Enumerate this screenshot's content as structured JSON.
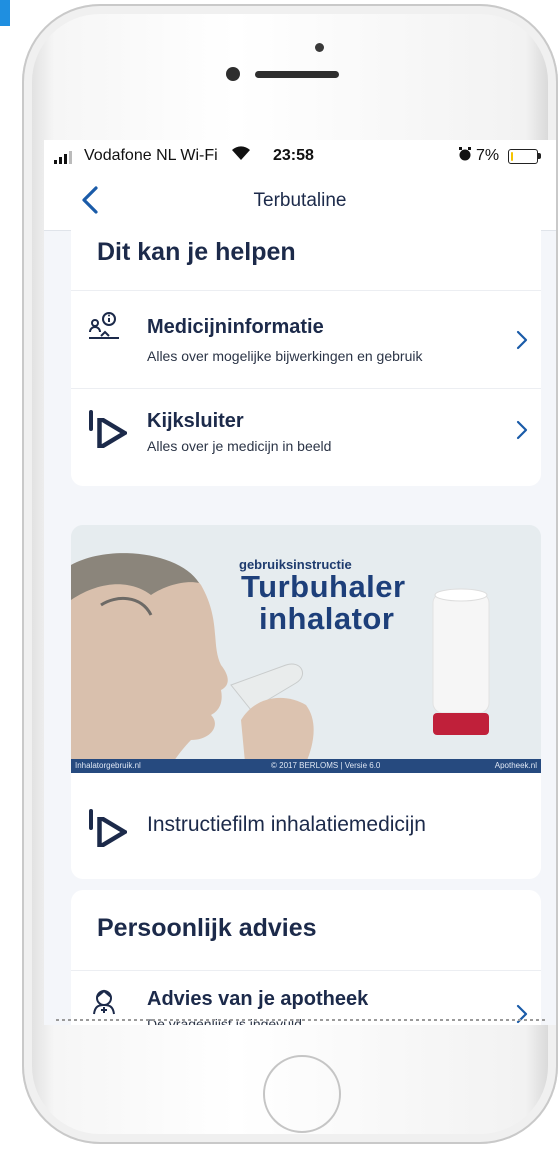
{
  "status_bar": {
    "carrier": "Vodafone NL Wi-Fi",
    "time": "23:58",
    "battery_percent": "7%",
    "battery_level": 0.07,
    "signal_icon": "signal-icon",
    "wifi_icon": "wifi-icon",
    "alarm_icon": "alarm-icon"
  },
  "nav": {
    "title": "Terbutaline",
    "back_icon": "chevron-left-icon"
  },
  "help_section": {
    "title": "Dit kan je helpen",
    "items": [
      {
        "icon": "medicine-info-icon",
        "label": "Medicijninformatie",
        "subtitle": "Alles over mogelijke bijwerkingen en gebruik"
      },
      {
        "icon": "play-icon",
        "label": "Kijksluiter",
        "subtitle": "Alles over je medicijn in beeld"
      }
    ]
  },
  "video": {
    "thumbnail": {
      "small_title": "gebruiksinstructie",
      "main_title_line1": "Turbuhaler",
      "main_title_line2": "inhalator",
      "footer_left": "Inhalatorgebruik.nl",
      "footer_center": "© 2017 BERLOMS | Versie 6.0",
      "footer_right": "Apotheek.nl"
    },
    "label": "Instructiefilm inhalatiemedicijn",
    "icon": "play-icon"
  },
  "advice_section": {
    "title": "Persoonlijk advies",
    "items": [
      {
        "icon": "pharmacist-icon",
        "label": "Advies van je apotheek",
        "subtitle": "De vragenlijst is ingevuld"
      }
    ]
  },
  "colors": {
    "accent": "#1a5ba8",
    "text_dark": "#1c2a4a",
    "screen_background": "#f4f6fa",
    "battery_low": "#f5c400"
  }
}
